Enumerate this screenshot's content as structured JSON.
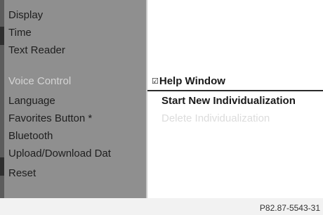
{
  "menu": {
    "items": [
      {
        "label": "Display",
        "state": "normal"
      },
      {
        "label": "Time",
        "state": "normal"
      },
      {
        "label": "Text Reader",
        "state": "normal"
      },
      {
        "label": "Voice Control",
        "state": "selected"
      },
      {
        "label": "Language",
        "state": "normal"
      },
      {
        "label": "Favorites Button *",
        "state": "normal"
      },
      {
        "label": "Bluetooth",
        "state": "normal"
      },
      {
        "label": "Upload/Download Dat",
        "state": "normal"
      },
      {
        "label": "Reset",
        "state": "normal"
      }
    ]
  },
  "submenu": {
    "items": [
      {
        "label": "Help Window",
        "checked": true,
        "state": "highlighted"
      },
      {
        "label": "Start New Individualization",
        "state": "enabled"
      },
      {
        "label": "Delete Individualization",
        "state": "disabled"
      }
    ],
    "check_glyph": "☑"
  },
  "footer": {
    "code": "P82.87-5543-31"
  },
  "colors": {
    "left_panel_bg": "#8f8f8f",
    "right_panel_bg": "#ffffff",
    "text_dark": "#1e1e1e",
    "text_faded": "#d5d5d5"
  }
}
